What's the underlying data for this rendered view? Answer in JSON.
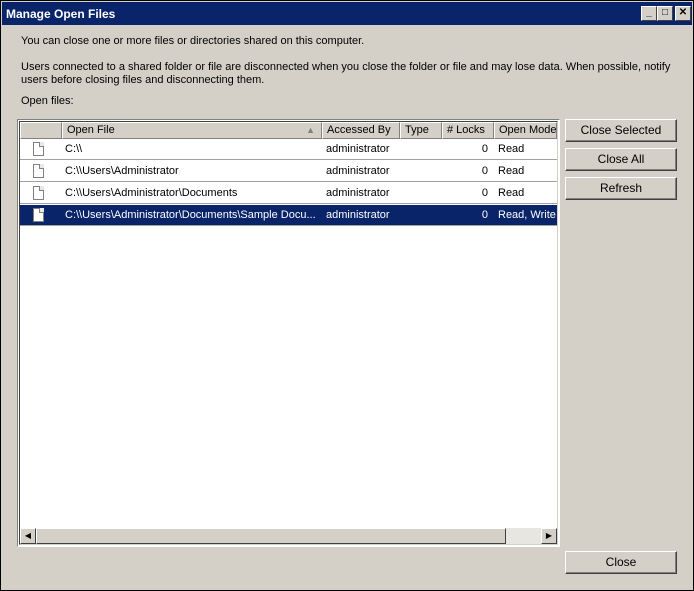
{
  "window": {
    "title": "Manage Open Files",
    "minimize_glyph": "_",
    "maximize_glyph": "□",
    "close_glyph": "✕"
  },
  "intro_text": "You can close one or more files or directories shared on this computer.",
  "warning_line1": "Users connected to a shared folder or file are disconnected when you close the folder or file and may lose data. When possible, notify",
  "warning_line2": "users before closing files and disconnecting them.",
  "open_files_label": "Open files:",
  "table": {
    "columns": [
      "",
      "Open File",
      "Accessed By",
      "Type",
      "# Locks",
      "Open Mode"
    ],
    "sort_indicator": "▲",
    "rows": [
      {
        "icon": "file-icon",
        "open_file": "C:\\\\",
        "accessed_by": "administrator",
        "type": "",
        "locks": "0",
        "open_mode": "Read"
      },
      {
        "icon": "file-icon",
        "open_file": "C:\\\\Users\\Administrator",
        "accessed_by": "administrator",
        "type": "",
        "locks": "0",
        "open_mode": "Read"
      },
      {
        "icon": "file-icon",
        "open_file": "C:\\\\Users\\Administrator\\Documents",
        "accessed_by": "administrator",
        "type": "",
        "locks": "0",
        "open_mode": "Read"
      },
      {
        "icon": "file-icon",
        "open_file": "C:\\\\Users\\Administrator\\Documents\\Sample Docu...",
        "accessed_by": "administrator",
        "type": "",
        "locks": "0",
        "open_mode": "Read, Write"
      }
    ],
    "selected_row": 3
  },
  "scrollbar": {
    "left_arrow": "◀",
    "right_arrow": "▶"
  },
  "buttons": {
    "close_selected": "Close Selected",
    "close_all": "Close All",
    "refresh": "Refresh",
    "close": "Close"
  },
  "colors": {
    "selection": "#0a246a",
    "title_bar": "#0a246a",
    "dialog_bg": "#d4d0c8"
  }
}
